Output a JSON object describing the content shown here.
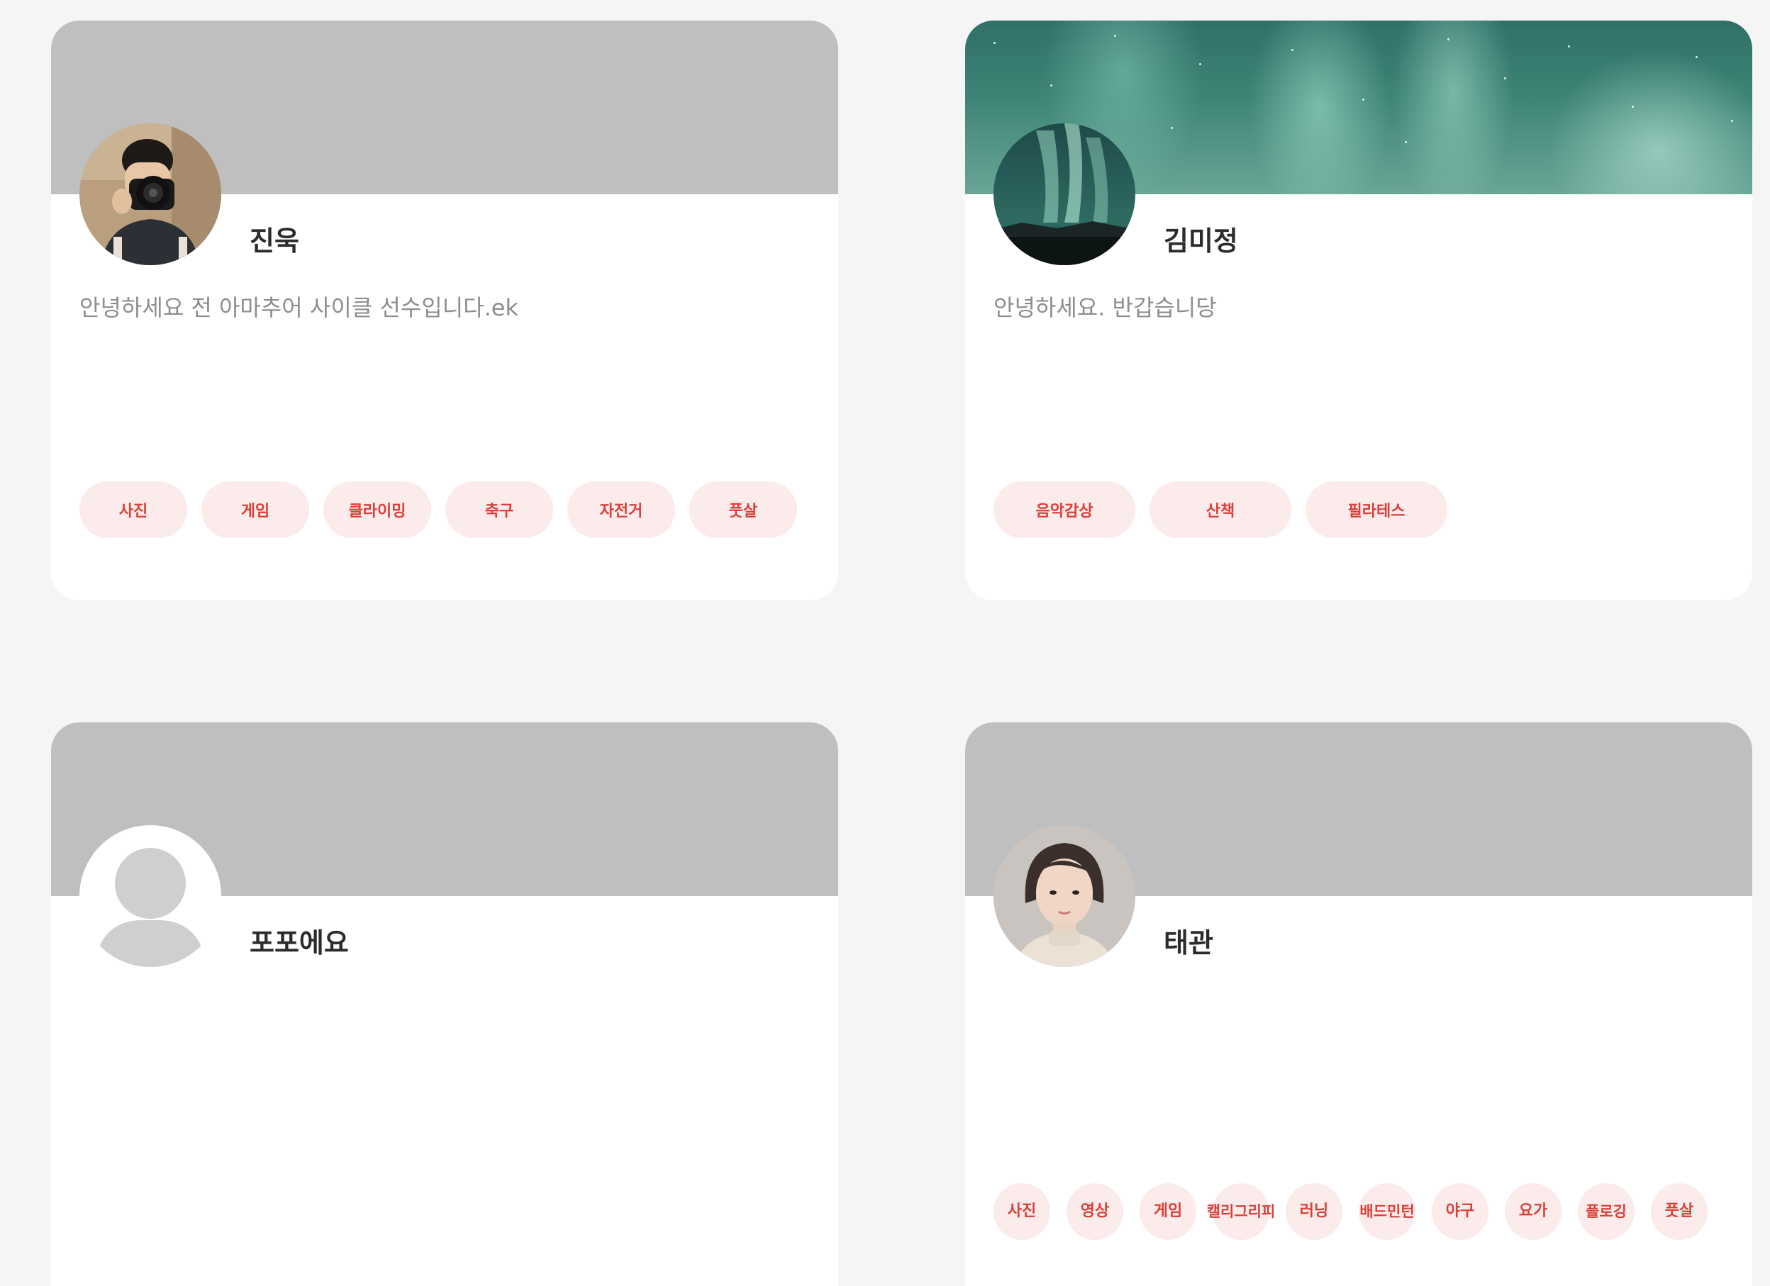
{
  "profiles": [
    {
      "name": "진욱",
      "bio": "안녕하세요 전 아마추어 사이클 선수입니다.ek",
      "banner": "gray",
      "avatar": "photo-man-with-camera",
      "tags": [
        "사진",
        "게임",
        "클라이밍",
        "축구",
        "자전거",
        "풋살"
      ]
    },
    {
      "name": "김미정",
      "bio": "안녕하세요. 반갑습니당",
      "banner": "aurora",
      "avatar": "aurora-photo",
      "tags": [
        "음악감상",
        "산책",
        "필라테스"
      ]
    },
    {
      "name": "포포에요",
      "bio": "",
      "banner": "gray",
      "avatar": "default-user-icon",
      "tags": []
    },
    {
      "name": "태관",
      "bio": "",
      "banner": "gray",
      "avatar": "photo-woman-portrait",
      "tags": [
        "사진",
        "영상",
        "게임",
        "캘리그리피",
        "러닝",
        "배드민턴",
        "야구",
        "요가",
        "플로깅",
        "풋살"
      ]
    }
  ],
  "colors": {
    "background": "#f5f5f5",
    "card": "#ffffff",
    "banner_gray": "#bfbfbf",
    "tag_bg": "#fbebea",
    "tag_text": "#d9413a",
    "name_text": "#2b2b2b",
    "bio_text": "#8e8e8e"
  }
}
